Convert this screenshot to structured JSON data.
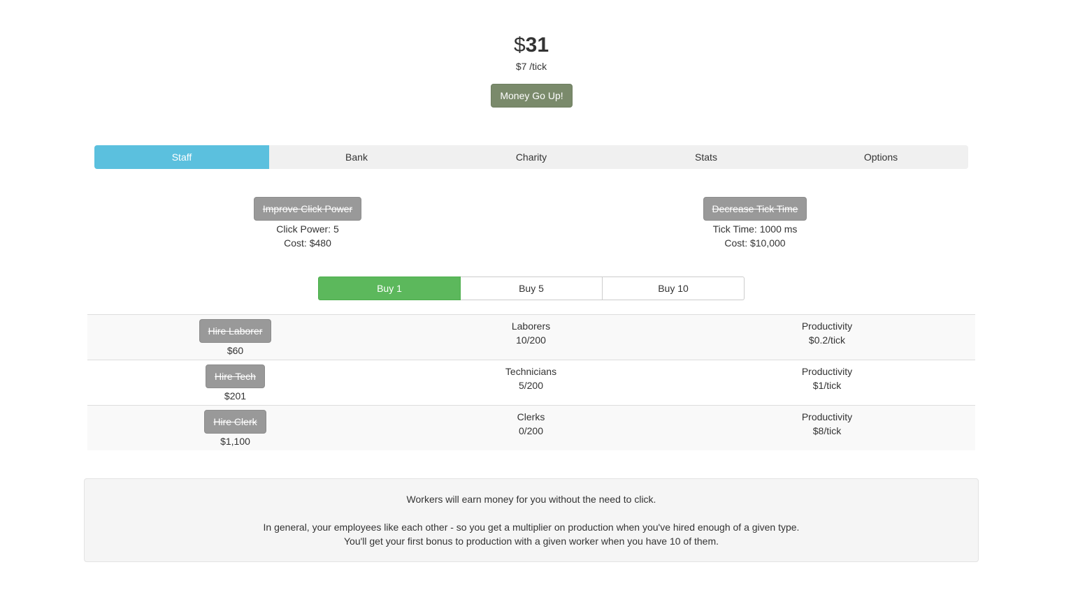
{
  "header": {
    "currency_symbol": "$",
    "money": "31",
    "rate": "$7 /tick",
    "click_button": "Money Go Up!"
  },
  "tabs": [
    {
      "label": "Staff",
      "active": true
    },
    {
      "label": "Bank",
      "active": false
    },
    {
      "label": "Charity",
      "active": false
    },
    {
      "label": "Stats",
      "active": false
    },
    {
      "label": "Options",
      "active": false
    }
  ],
  "upgrades": {
    "click_power": {
      "button": "Improve Click Power",
      "stat": "Click Power: 5",
      "cost": "Cost: $480"
    },
    "tick_time": {
      "button": "Decrease Tick Time",
      "stat": "Tick Time: 1000 ms",
      "cost": "Cost: $10,000"
    }
  },
  "buy_options": [
    {
      "label": "Buy 1",
      "active": true
    },
    {
      "label": "Buy 5",
      "active": false
    },
    {
      "label": "Buy 10",
      "active": false
    }
  ],
  "staff": [
    {
      "button": "Hire Laborer",
      "cost": "$60",
      "name": "Laborers",
      "count": "10/200",
      "prod_label": "Productivity",
      "prod": "$0.2/tick"
    },
    {
      "button": "Hire Tech",
      "cost": "$201",
      "name": "Technicians",
      "count": "5/200",
      "prod_label": "Productivity",
      "prod": "$1/tick"
    },
    {
      "button": "Hire Clerk",
      "cost": "$1,100",
      "name": "Clerks",
      "count": "0/200",
      "prod_label": "Productivity",
      "prod": "$8/tick"
    }
  ],
  "info": {
    "line1": "Workers will earn money for you without the need to click.",
    "line2": "In general, your employees like each other - so you get a multiplier on production when you've hired enough of a given type.",
    "line3": "You'll get your first bonus to production with a given worker when you have 10 of them."
  },
  "colors": {
    "tab_active": "#5bc0de",
    "buy_active": "#5cb85c",
    "click_button": "#7a8a6b",
    "disabled_button": "#999999"
  }
}
